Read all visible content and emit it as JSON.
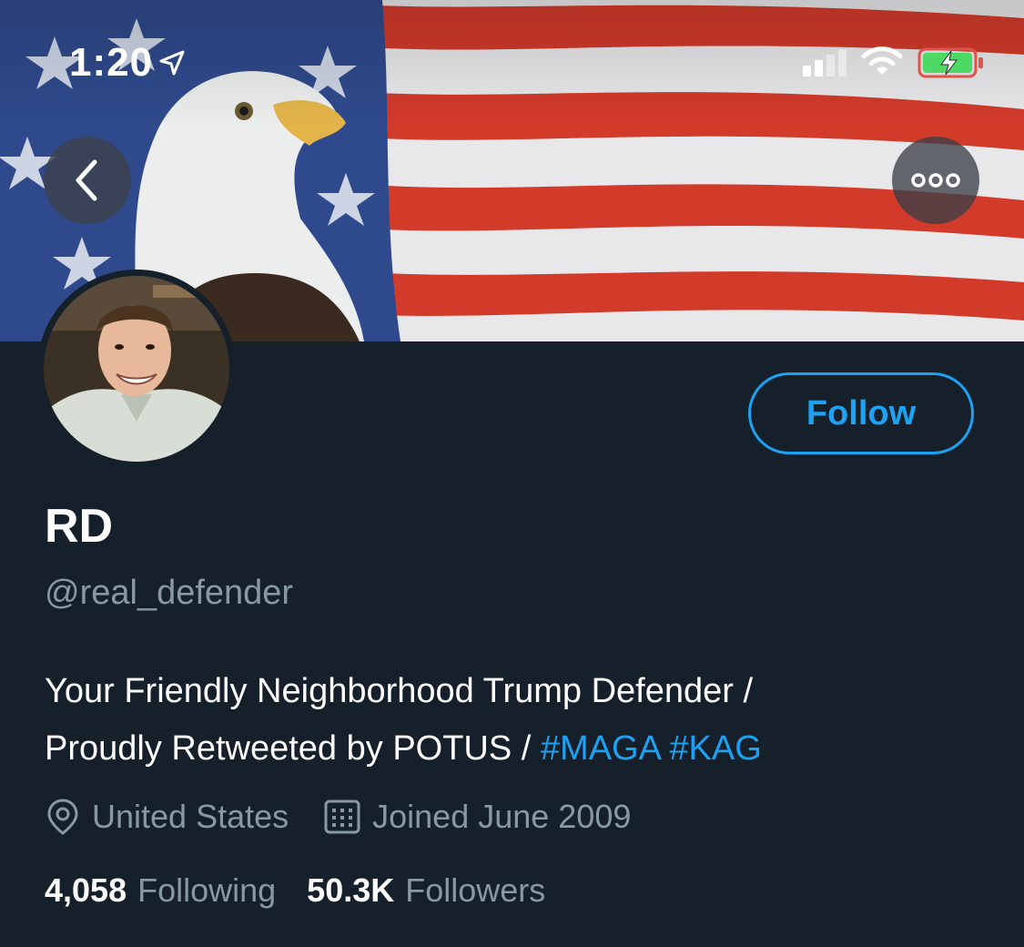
{
  "status_bar": {
    "time": "1:20",
    "battery_color": "#4cd964",
    "battery_outline_color": "#e0534a"
  },
  "header": {
    "back_icon": "chevron-left-icon",
    "more_icon": "more-horizontal-icon"
  },
  "profile": {
    "name": "RD",
    "handle": "@real_defender",
    "follow_label": "Follow",
    "bio": {
      "line1": "Your Friendly Neighborhood Trump Defender /",
      "line2_text": "Proudly Retweeted by POTUS / ",
      "hashtag1": "#MAGA",
      "hashtag2": "#KAG"
    },
    "location": "United States",
    "joined": "Joined June 2009",
    "following_count": "4,058",
    "following_label": "Following",
    "followers_count": "50.3K",
    "followers_label": "Followers"
  },
  "colors": {
    "background": "#15202b",
    "accent": "#1da1f2",
    "secondary_text": "#8899a6"
  }
}
